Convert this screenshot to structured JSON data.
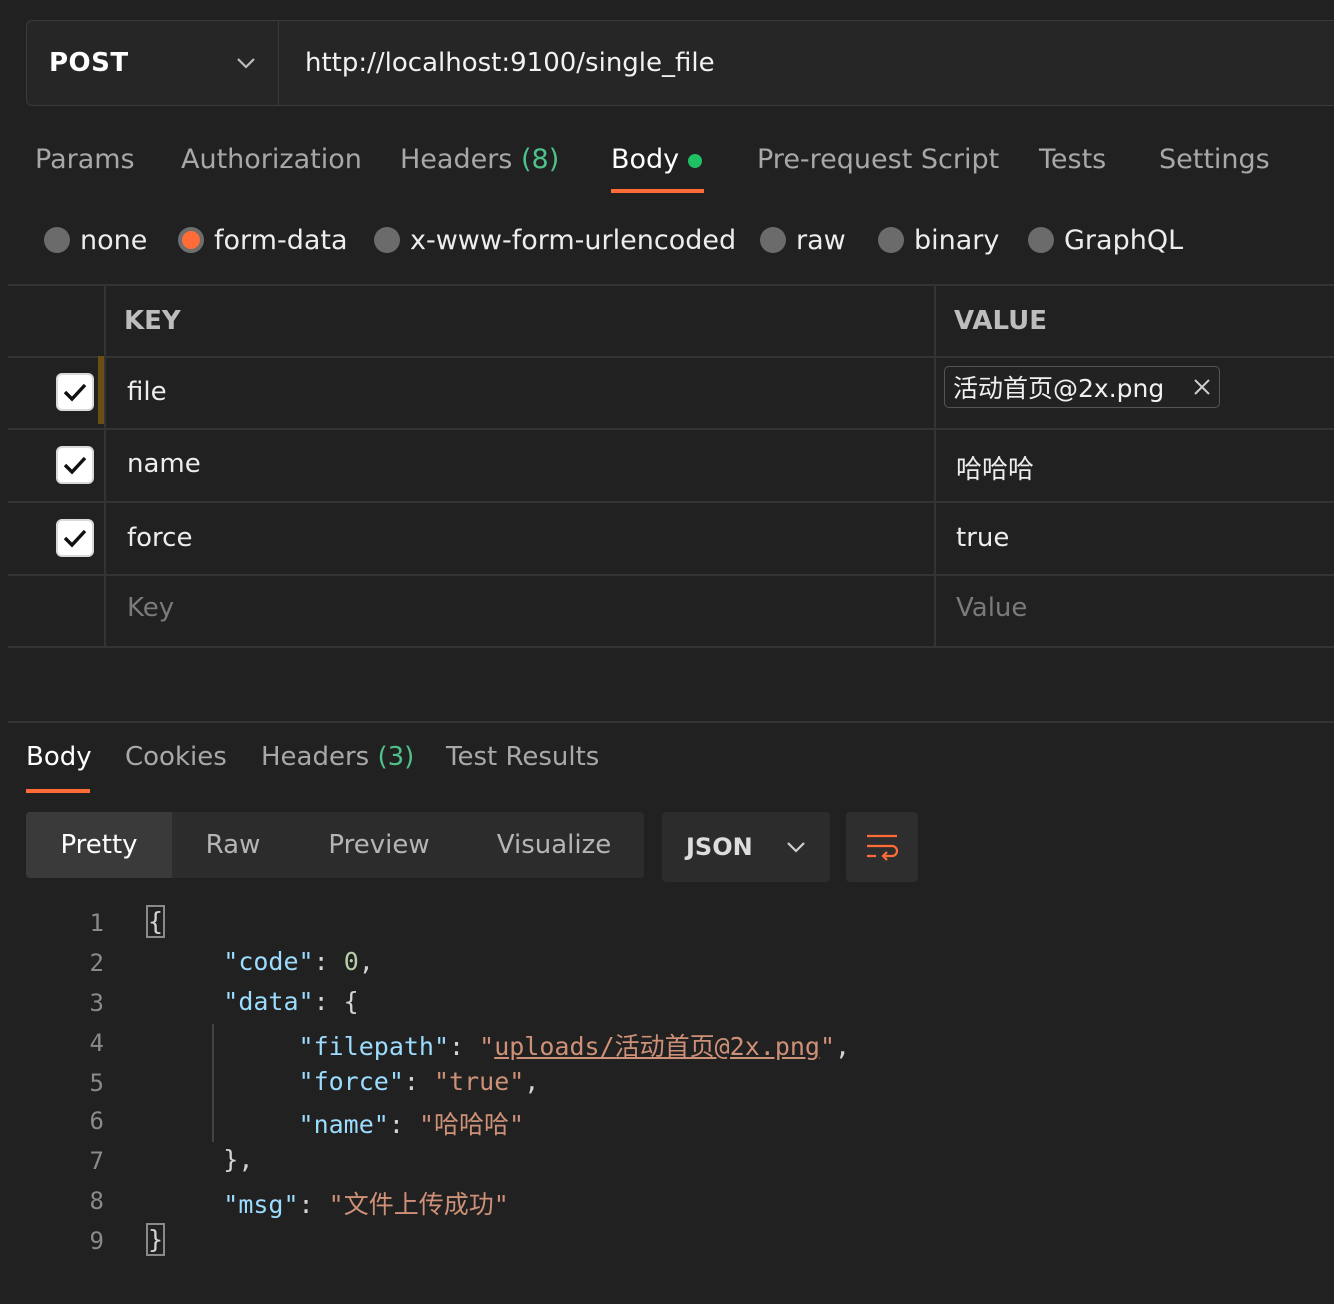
{
  "request": {
    "method": "POST",
    "url": "http://localhost:9100/single_file"
  },
  "request_tabs": [
    {
      "label": "Params"
    },
    {
      "label": "Authorization"
    },
    {
      "label": "Headers",
      "count": "(8)"
    },
    {
      "label": "Body"
    },
    {
      "label": "Pre-request Script"
    },
    {
      "label": "Tests"
    },
    {
      "label": "Settings"
    }
  ],
  "body_types": [
    {
      "label": "none",
      "selected": false
    },
    {
      "label": "form-data",
      "selected": true
    },
    {
      "label": "x-www-form-urlencoded",
      "selected": false
    },
    {
      "label": "raw",
      "selected": false
    },
    {
      "label": "binary",
      "selected": false
    },
    {
      "label": "GraphQL",
      "selected": false
    }
  ],
  "form_table": {
    "key_header": "KEY",
    "value_header": "VALUE",
    "rows": [
      {
        "key": "file",
        "value": "活动首页@2x.png",
        "checked": true
      },
      {
        "key": "name",
        "value": "哈哈哈",
        "checked": true
      },
      {
        "key": "force",
        "value": "true",
        "checked": true
      }
    ],
    "key_placeholder": "Key",
    "value_placeholder": "Value"
  },
  "response_tabs": [
    {
      "label": "Body"
    },
    {
      "label": "Cookies"
    },
    {
      "label": "Headers",
      "count": "(3)"
    },
    {
      "label": "Test Results"
    }
  ],
  "view_modes": [
    "Pretty",
    "Raw",
    "Preview",
    "Visualize"
  ],
  "format": "JSON",
  "code_lines": {
    "numbers": [
      "1",
      "2",
      "3",
      "4",
      "5",
      "6",
      "7",
      "8",
      "9"
    ],
    "open_brace": "{",
    "close_brace": "}",
    "code_key": "\"code\"",
    "code_value": "0",
    "data_key": "\"data\"",
    "filepath_key": "\"filepath\"",
    "filepath_quote_open": "\"",
    "filepath_link": "uploads/活动首页@2x.png",
    "filepath_quote_close": "\"",
    "force_key": "\"force\"",
    "force_value": "\"true\"",
    "name_key": "\"name\"",
    "name_value": "\"哈哈哈\"",
    "data_close": "},",
    "msg_key": "\"msg\"",
    "msg_value": "\"文件上传成功\""
  },
  "colors": {
    "accent": "#ff6c37",
    "status_dot": "#20c164",
    "count_green": "#4fc18a"
  }
}
